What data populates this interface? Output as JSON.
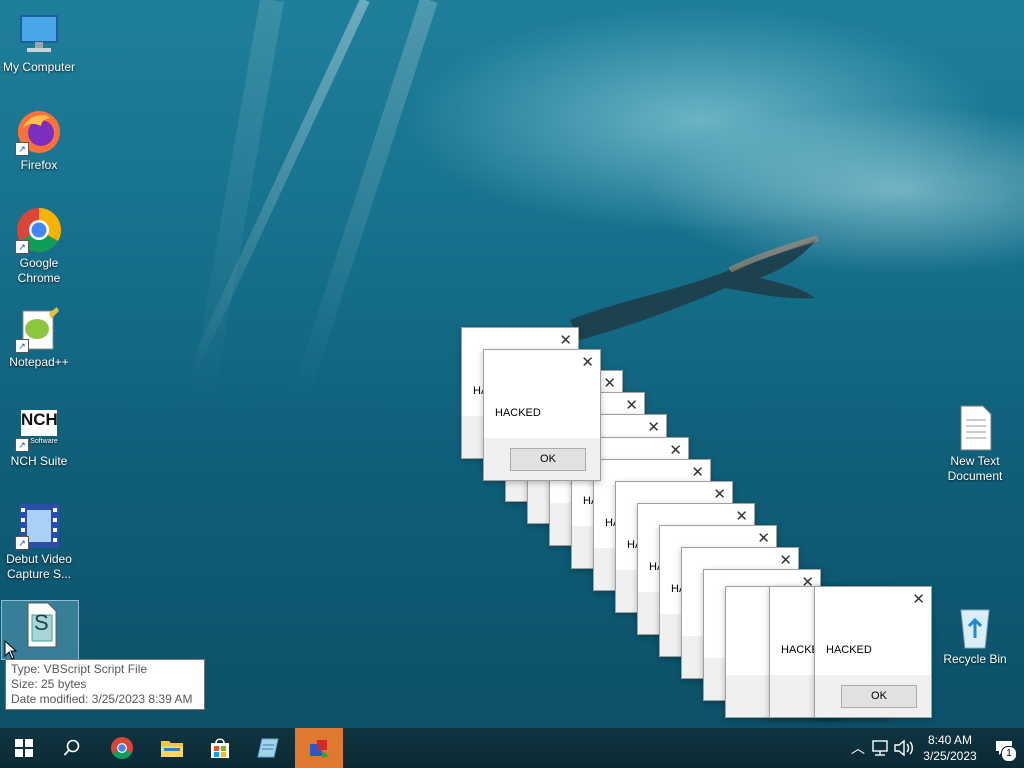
{
  "desktop": {
    "icons": [
      {
        "label": "My Computer"
      },
      {
        "label": "Firefox"
      },
      {
        "label": "Google Chrome"
      },
      {
        "label": "Notepad++"
      },
      {
        "label": "NCH Suite"
      },
      {
        "label": "Debut Video Capture S..."
      },
      {
        "label": "New Text Document"
      },
      {
        "label": "Recycle Bin"
      }
    ],
    "nch_badge": "NCH",
    "nch_sub": "Software",
    "vbs_glyph": "S"
  },
  "tooltip": {
    "type": "Type: VBScript Script File",
    "size": "Size: 25 bytes",
    "modified": "Date modified: 3/25/2023 8:39 AM"
  },
  "dialog": {
    "message": "HACKED",
    "partial_message": "HACKE",
    "partial_short": "HAC",
    "partial_two": "HA",
    "ok_label": "OK",
    "close_glyph": "✕"
  },
  "taskbar": {
    "time": "8:40 AM",
    "date": "3/25/2023",
    "notification_count": "1",
    "buttons": [
      "start",
      "search",
      "chrome",
      "file-explorer",
      "microsoft-store",
      "notepad",
      "active-app"
    ]
  },
  "colors": {
    "taskbar_bg": "#0b2a35",
    "active_app": "#e07830",
    "dialog_footer": "#f0f0f0"
  }
}
